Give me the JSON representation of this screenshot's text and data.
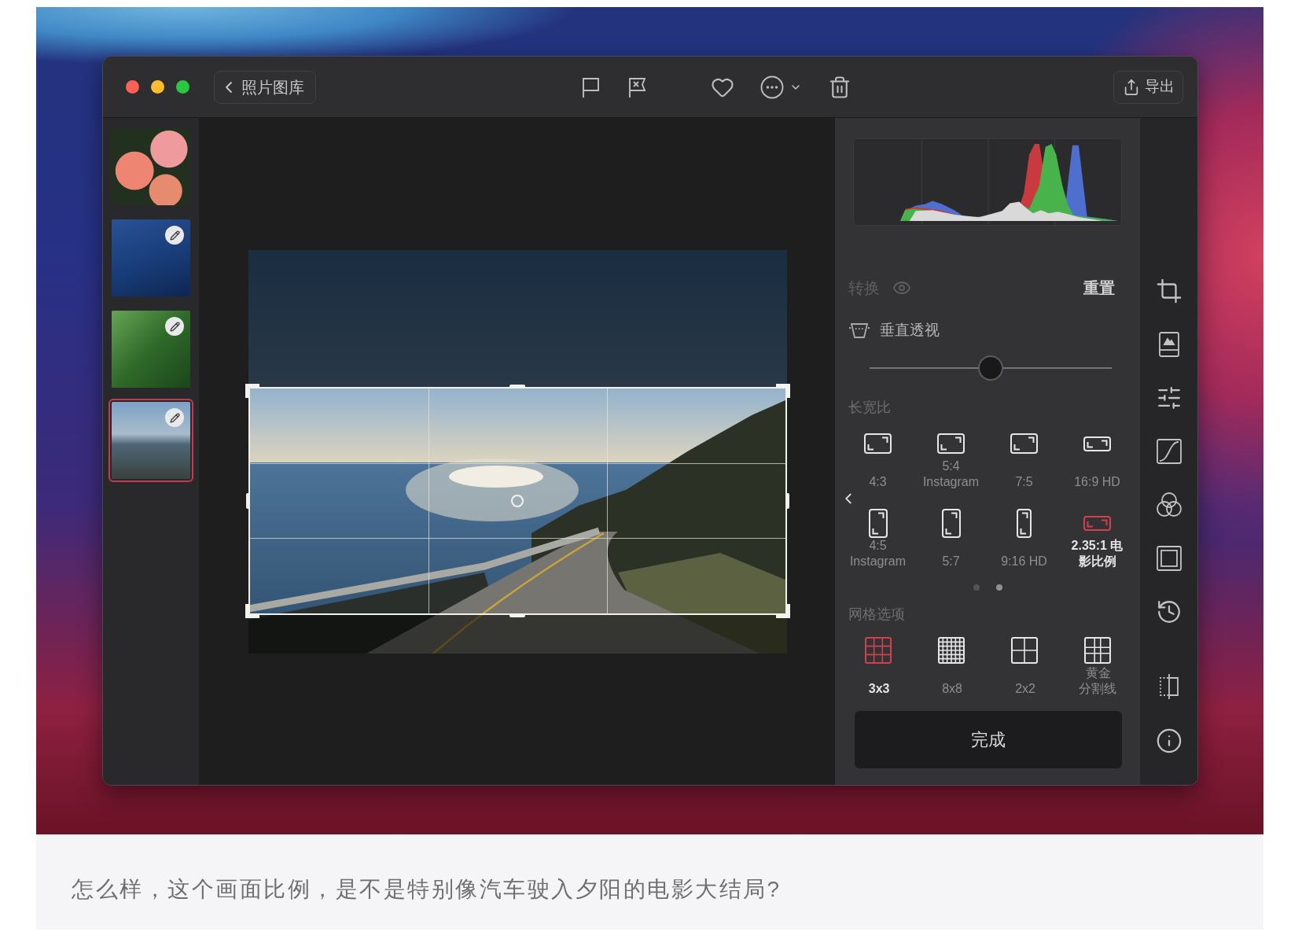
{
  "toolbar": {
    "back_button": "照片图库",
    "export_button": "导出"
  },
  "thumbnails": [
    {
      "selected": false,
      "edited": false
    },
    {
      "selected": false,
      "edited": true
    },
    {
      "selected": false,
      "edited": true
    },
    {
      "selected": true,
      "edited": true
    }
  ],
  "transform": {
    "title": "转换",
    "reset_button": "重置",
    "perspective": {
      "label": "垂直透视",
      "level": 0.5
    }
  },
  "aspect_ratio": {
    "title": "长宽比",
    "options": [
      {
        "label": "4:3",
        "kind": "landscape",
        "selected": false
      },
      {
        "label": "5:4 Instagram",
        "kind": "landscape",
        "selected": false
      },
      {
        "label": "7:5",
        "kind": "landscape",
        "selected": false
      },
      {
        "label": "16:9 HD",
        "kind": "wide",
        "selected": false
      },
      {
        "label": "4:5 Instagram",
        "kind": "portrait",
        "selected": false
      },
      {
        "label": "5:7",
        "kind": "portrait",
        "selected": false
      },
      {
        "label": "9:16 HD",
        "kind": "tall",
        "selected": false
      },
      {
        "label": "2.35:1 电影比例",
        "kind": "wide",
        "selected": true
      }
    ],
    "pages": [
      {
        "selected": false
      },
      {
        "selected": true
      }
    ]
  },
  "grid_options": {
    "title": "网格选项",
    "options": [
      {
        "label": "3x3",
        "kind": "thirds",
        "selected": true
      },
      {
        "label": "8x8",
        "kind": "fine",
        "selected": false
      },
      {
        "label": "2x2",
        "kind": "quarters",
        "selected": false
      },
      {
        "label": "黄金分割线",
        "kind": "golden",
        "selected": false
      }
    ]
  },
  "done_button": "完成",
  "caption": "怎么样，这个画面比例，是不是特别像汽车驶入夕阳的电影大结局?"
}
